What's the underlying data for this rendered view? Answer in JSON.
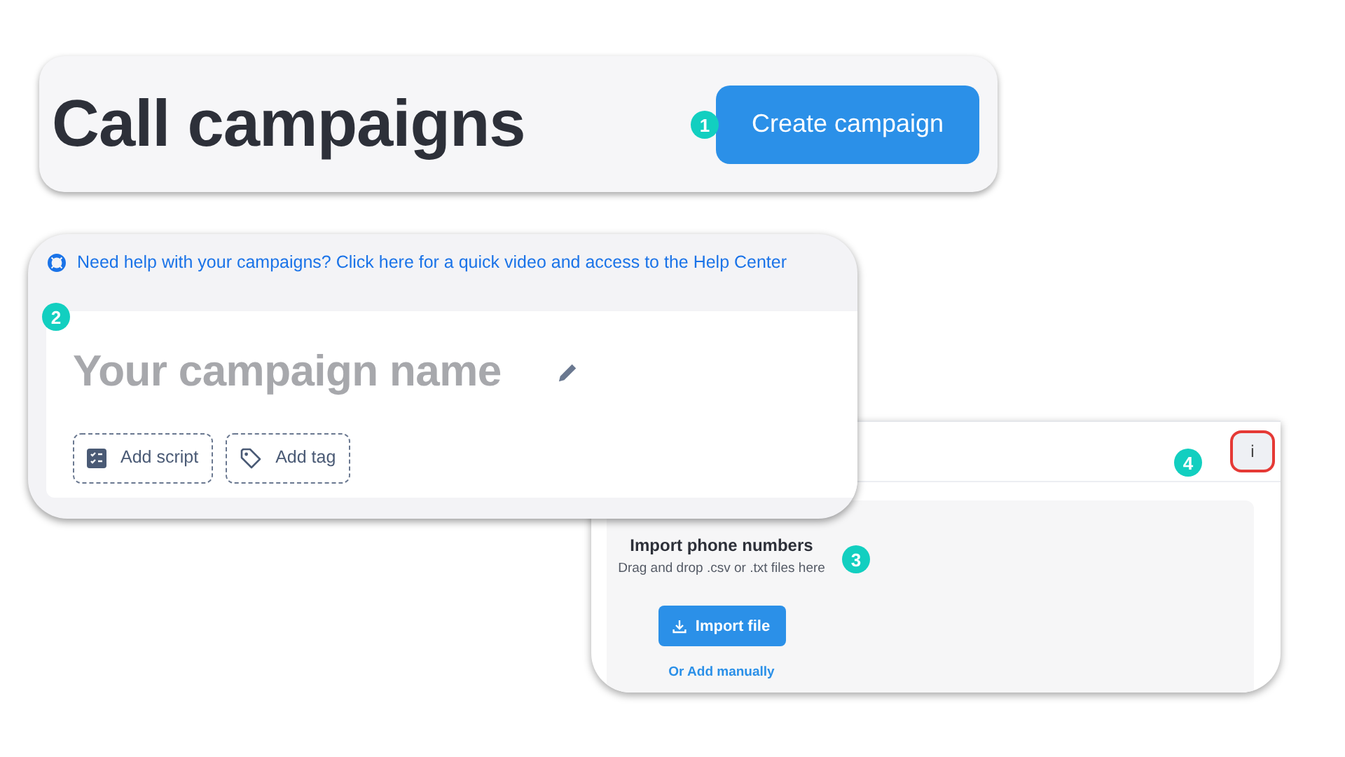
{
  "header": {
    "title": "Call campaigns",
    "create_button": "Create campaign"
  },
  "help_link": "Need help with your campaigns? Click here for a quick video and access to the Help Center",
  "campaign": {
    "name_field": {
      "placeholder": "Your campaign name"
    },
    "actions": [
      {
        "label": "Add script",
        "kind": "script"
      },
      {
        "label": "Add tag",
        "kind": "tag"
      }
    ]
  },
  "import": {
    "title": "Import phone numbers",
    "hint": "Drag and drop .csv or .txt files here",
    "button": "Import file",
    "manual_link": "Or Add manually",
    "info_button": "i"
  },
  "callouts": [
    "1",
    "2",
    "3",
    "4"
  ]
}
